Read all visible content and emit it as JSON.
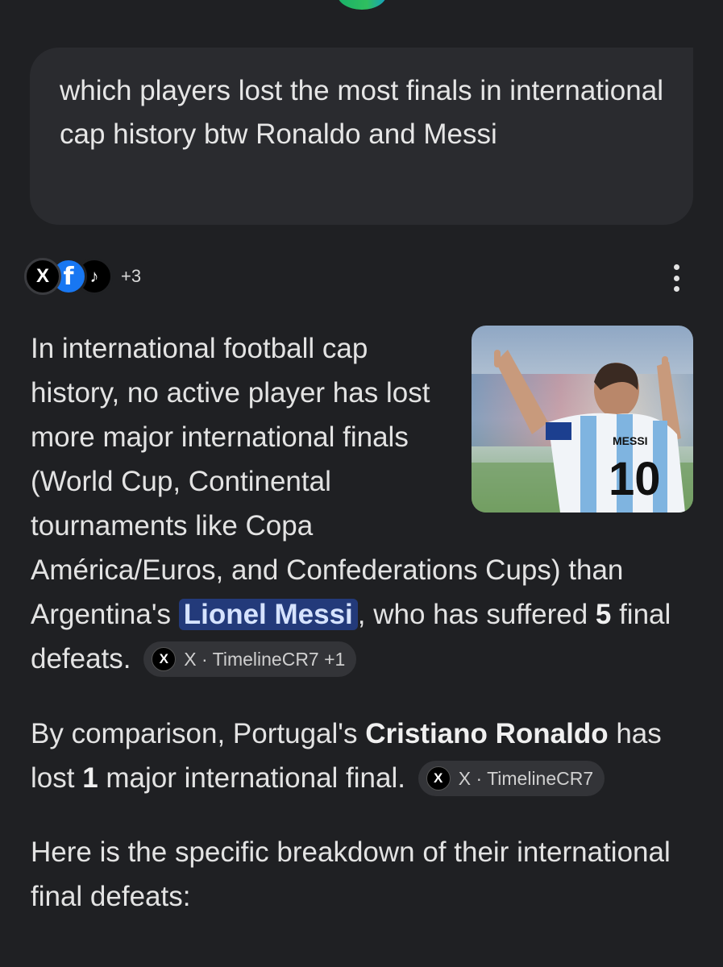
{
  "query": {
    "text": "which players lost the most finals in international cap history btw Ronaldo and Messi"
  },
  "sources": {
    "icons": [
      "x-icon",
      "facebook-icon",
      "tiktok-icon"
    ],
    "x_glyph": "X",
    "facebook_glyph": "f",
    "tiktok_glyph": "♪",
    "more": "+3"
  },
  "answer": {
    "p1_text_a": "In international football cap history, no active player has lost more major international finals (World Cup, Continental tournaments like Copa América/Euros, and Confederations Cups) than Argentina's ",
    "p1_highlight": "Lionel Messi",
    "p1_text_b": ", who has suffered ",
    "p1_bold": "5",
    "p1_text_c": " final defeats.",
    "p1_chip": "X · TimelineCR7 +1",
    "p2_text_a": "By comparison, Portugal's ",
    "p2_bold_name": "Cristiano Ronaldo",
    "p2_text_b": " has lost ",
    "p2_bold_num": "1",
    "p2_text_c": " major international final.",
    "p2_chip": "X · TimelineCR7",
    "p3_text": "Here is the specific breakdown of their international final defeats:"
  },
  "image": {
    "jersey_name": "MESSI",
    "jersey_number": "10"
  },
  "colors": {
    "background": "#1f2023",
    "bubble": "#2a2b2f",
    "highlight_bg": "#233a7a",
    "chip_bg": "#333438"
  }
}
